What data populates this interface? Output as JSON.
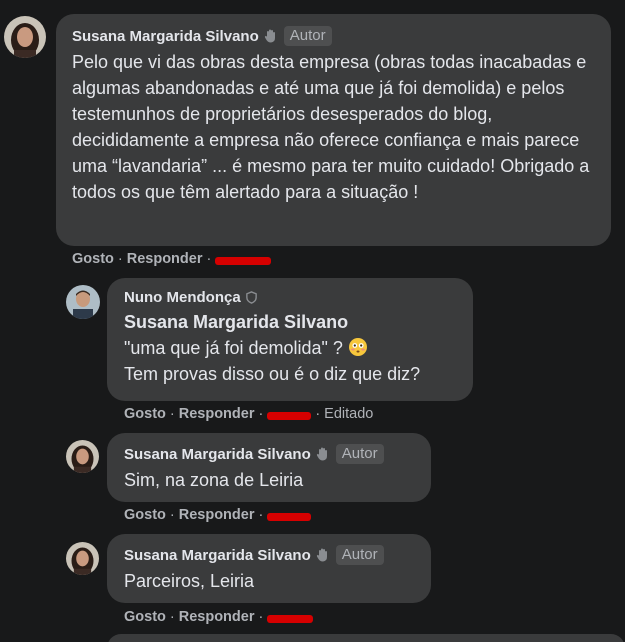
{
  "comments": [
    {
      "author": "Susana Margarida Silvano",
      "badge": "Autor",
      "text": "Pelo que vi das obras desta empresa (obras todas inacabadas e algumas abandonadas e até uma que já foi demolida) e pelos testemunhos de proprietários desesperados do blog, decididamente a empresa não oferece confiança e mais parece uma “lavandaria” ... é mesmo para ter muito cuidado! Obrigado a todos os que têm alertado para a situação !",
      "like_label": "Gosto",
      "reply_label": "Responder"
    },
    {
      "author": "Nuno Mendonça",
      "mention": "Susana Margarida Silvano",
      "line1": "\"uma que já foi demolida\" ?",
      "line2": "Tem provas disso ou é o diz que diz?",
      "like_label": "Gosto",
      "reply_label": "Responder",
      "edited_label": "Editado"
    },
    {
      "author": "Susana Margarida Silvano",
      "badge": "Autor",
      "text": "Sim, na zona de Leiria",
      "like_label": "Gosto",
      "reply_label": "Responder"
    },
    {
      "author": "Susana Margarida Silvano",
      "badge": "Autor",
      "text": "Parceiros, Leiria",
      "like_label": "Gosto",
      "reply_label": "Responder"
    }
  ],
  "separator": "·",
  "icons": {
    "author_badge_icon": "waving-hand-icon",
    "mod_icon": "shield-icon",
    "emoji": "flushed-face-emoji"
  },
  "colors": {
    "background": "#18191a",
    "bubble": "#3a3b3c",
    "text": "#e4e6eb",
    "muted": "#b0b3b8",
    "redaction": "#d60000"
  }
}
